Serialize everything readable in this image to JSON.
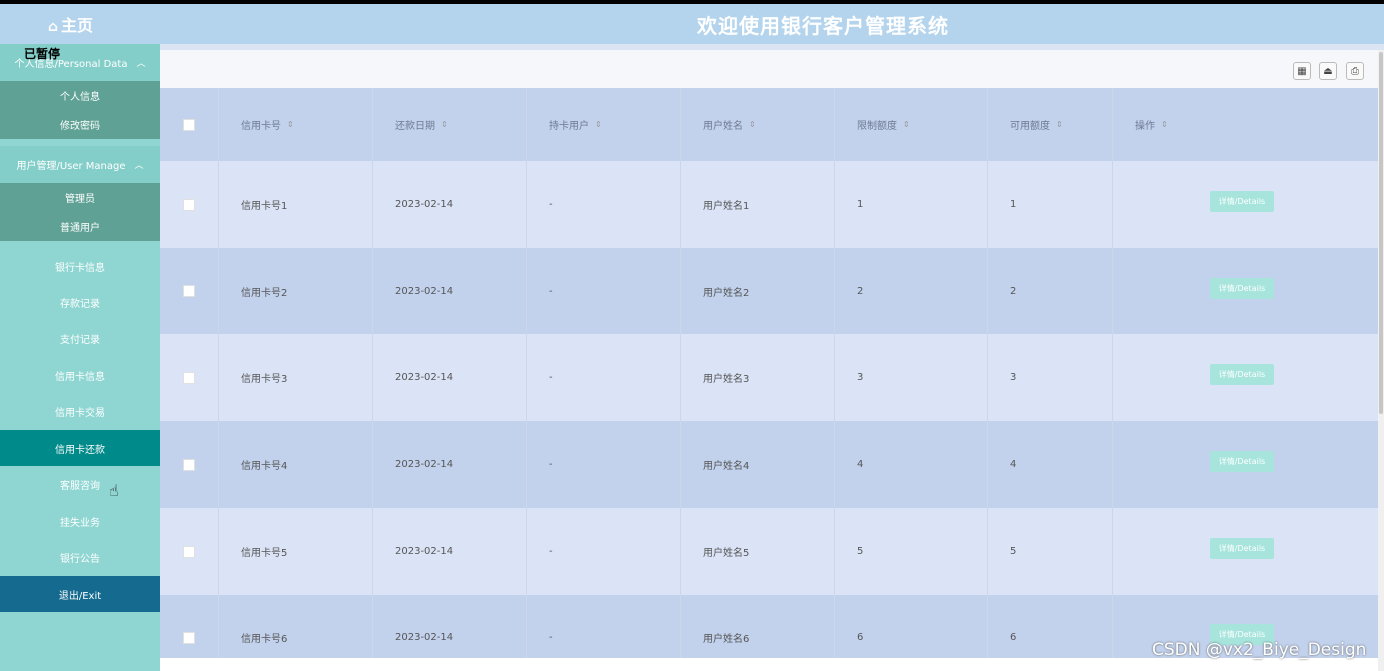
{
  "header": {
    "home_icon": "home-icon",
    "home_label": "主页",
    "title": "欢迎使用银行客户管理系统"
  },
  "overlay": {
    "text": "已暂停"
  },
  "sidebar": {
    "groups": [
      {
        "label": "个人信息/Personal Data",
        "chevron": "chevron-up-icon",
        "items": [
          "个人信息",
          "修改密码"
        ]
      },
      {
        "label": "用户管理/User Manage",
        "chevron": "chevron-up-icon",
        "items": [
          "管理员",
          "普通用户"
        ]
      }
    ],
    "items": [
      "银行卡信息",
      "存款记录",
      "支付记录",
      "信用卡信息",
      "信用卡交易",
      "信用卡还款",
      "客服咨询",
      "挂失业务",
      "银行公告"
    ],
    "active_item": "信用卡还款",
    "exit_label": "退出/Exit"
  },
  "toolbar": {
    "icons": [
      "columns-icon",
      "export-icon",
      "print-icon"
    ]
  },
  "table": {
    "headers": [
      "信用卡号",
      "还款日期",
      "持卡用户",
      "用户姓名",
      "限制额度",
      "可用额度",
      "操作"
    ],
    "rows": [
      {
        "card": "信用卡号1",
        "date": "2023-02-14",
        "holder": "-",
        "name": "用户姓名1",
        "limit": "1",
        "available": "1",
        "action": "详情/Details"
      },
      {
        "card": "信用卡号2",
        "date": "2023-02-14",
        "holder": "-",
        "name": "用户姓名2",
        "limit": "2",
        "available": "2",
        "action": "详情/Details"
      },
      {
        "card": "信用卡号3",
        "date": "2023-02-14",
        "holder": "-",
        "name": "用户姓名3",
        "limit": "3",
        "available": "3",
        "action": "详情/Details"
      },
      {
        "card": "信用卡号4",
        "date": "2023-02-14",
        "holder": "-",
        "name": "用户姓名4",
        "limit": "4",
        "available": "4",
        "action": "详情/Details"
      },
      {
        "card": "信用卡号5",
        "date": "2023-02-14",
        "holder": "-",
        "name": "用户姓名5",
        "limit": "5",
        "available": "5",
        "action": "详情/Details"
      },
      {
        "card": "信用卡号6",
        "date": "2023-02-14",
        "holder": "-",
        "name": "用户姓名6",
        "limit": "6",
        "available": "6",
        "action": "详情/Details"
      }
    ]
  },
  "watermark": "CSDN @vx2_Biye_Design",
  "colors": {
    "header_bg": "#b3d4ec",
    "sidebar_bg": "#8fd6d2",
    "sidebar_sub_bg": "#5fa295",
    "active_bg": "#008b8a",
    "exit_bg": "#156a8f",
    "table_header_bg": "#c2d2ed",
    "row_light": "#dbe4f6",
    "row_dark": "#c2d2ed",
    "details_btn": "#a6e4dc"
  }
}
